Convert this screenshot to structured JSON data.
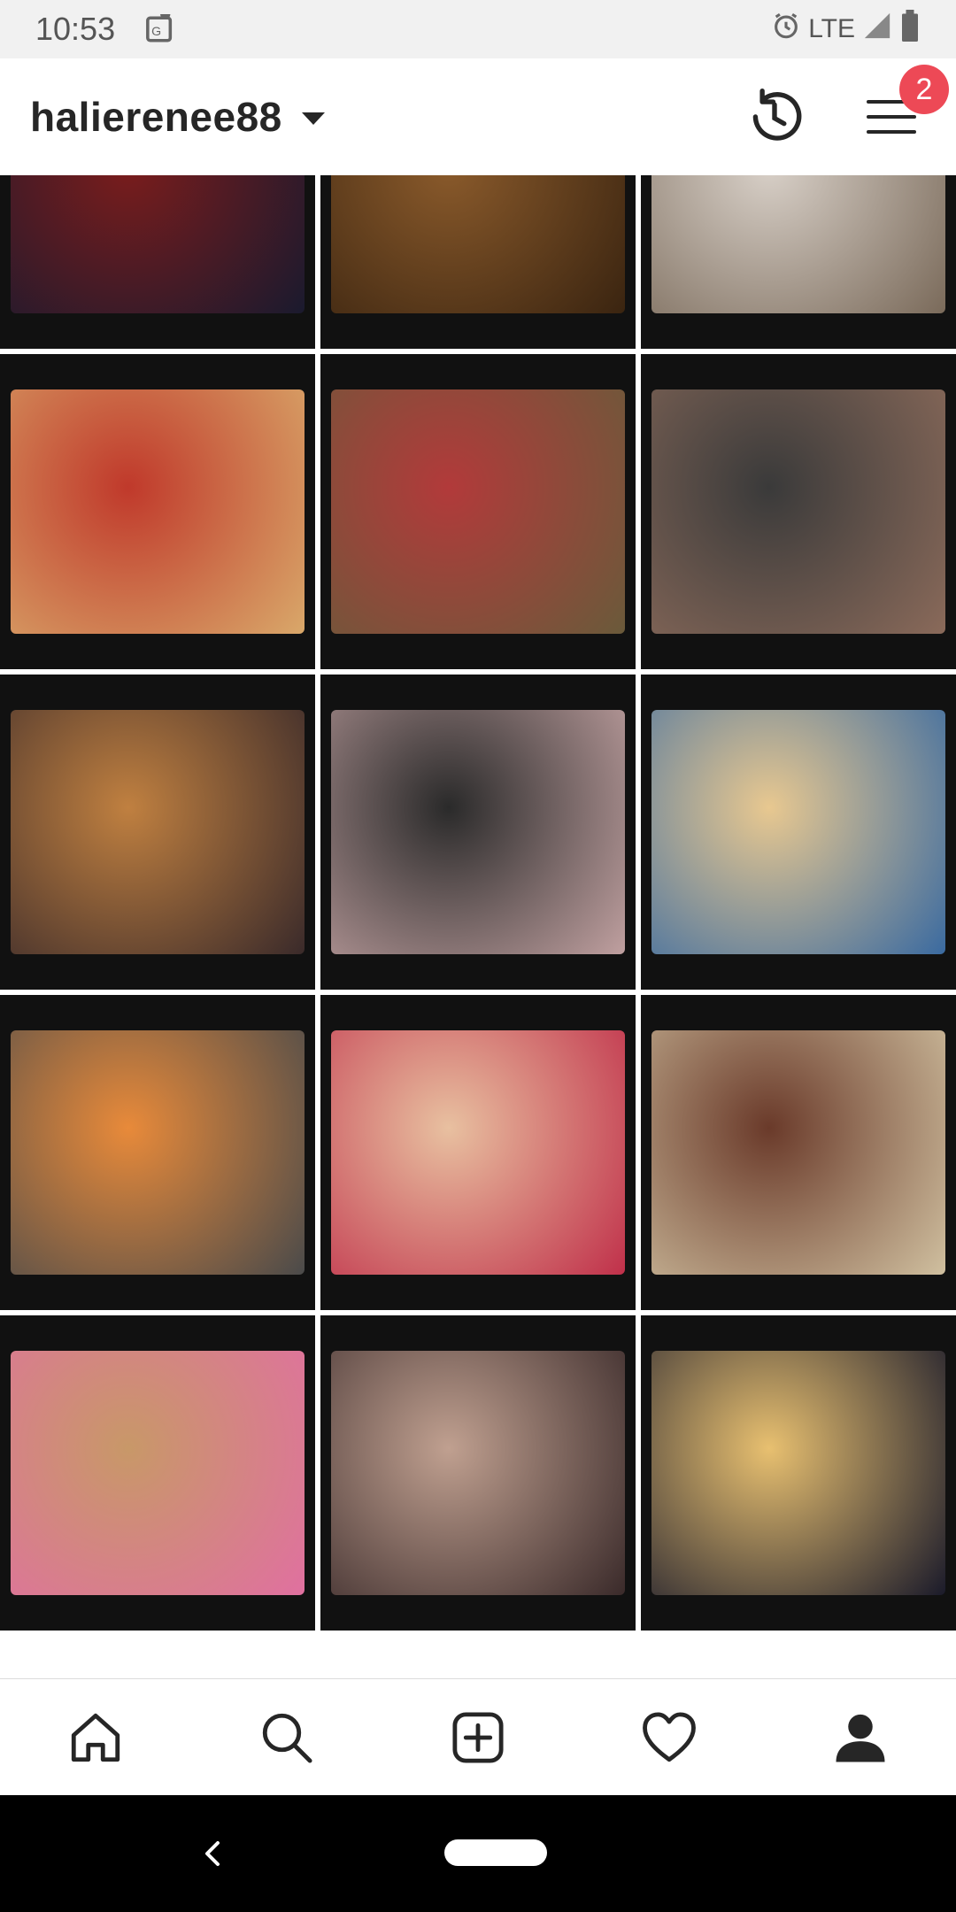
{
  "status_bar": {
    "time": "10:53",
    "network": "LTE",
    "icons": [
      "maps-icon",
      "alarm-icon",
      "signal-icon",
      "battery-icon"
    ]
  },
  "header": {
    "username": "halierenee88",
    "dropdown_icon": "chevron-down-icon",
    "archive_icon": "history-icon",
    "menu_icon": "hamburger-menu-icon",
    "notification_count": "2"
  },
  "grid": {
    "posts": [
      {
        "name": "post-man-tie-selfie",
        "colors": [
          "#7a1c1c",
          "#1a1a2e"
        ]
      },
      {
        "name": "post-sombrero-man",
        "colors": [
          "#8a5a2b",
          "#3a2410"
        ]
      },
      {
        "name": "post-woman-mirror-selfie",
        "colors": [
          "#d8d0c8",
          "#7a6a5a"
        ]
      },
      {
        "name": "post-pancake-plate",
        "colors": [
          "#c0392b",
          "#d9a86a"
        ]
      },
      {
        "name": "post-cafe-cupcakes",
        "colors": [
          "#b23a3a",
          "#6a5a3a"
        ]
      },
      {
        "name": "post-feet-dog-couch",
        "colors": [
          "#3a3a3a",
          "#8a6a5a"
        ]
      },
      {
        "name": "post-guitars-wall",
        "colors": [
          "#c08040",
          "#3a2a2a"
        ]
      },
      {
        "name": "post-guitar-closeup",
        "colors": [
          "#2a2a2a",
          "#c0a0a0"
        ]
      },
      {
        "name": "post-two-friends-headphones",
        "colors": [
          "#e8c890",
          "#3a6aa0"
        ]
      },
      {
        "name": "post-orange-smoothie",
        "colors": [
          "#e88a3a",
          "#4a4a4a"
        ]
      },
      {
        "name": "post-woman-car-smile",
        "colors": [
          "#e8c0a0",
          "#c0304a"
        ]
      },
      {
        "name": "post-trammell-nameplate",
        "colors": [
          "#6a3a2a",
          "#d0c0a0"
        ]
      },
      {
        "name": "post-rubber-band-ball",
        "colors": [
          "#c89868",
          "#e070a0"
        ]
      },
      {
        "name": "post-man-glasses-car",
        "colors": [
          "#c0a090",
          "#3a2a2a"
        ]
      },
      {
        "name": "post-woman-car-blonde",
        "colors": [
          "#e8c070",
          "#1a1a2a"
        ]
      }
    ]
  },
  "bottom_nav": {
    "items": [
      {
        "name": "home-icon"
      },
      {
        "name": "search-icon"
      },
      {
        "name": "new-post-icon"
      },
      {
        "name": "activity-heart-icon"
      },
      {
        "name": "profile-icon"
      }
    ]
  },
  "colors": {
    "badge": "#ed4956",
    "text": "#262626"
  }
}
